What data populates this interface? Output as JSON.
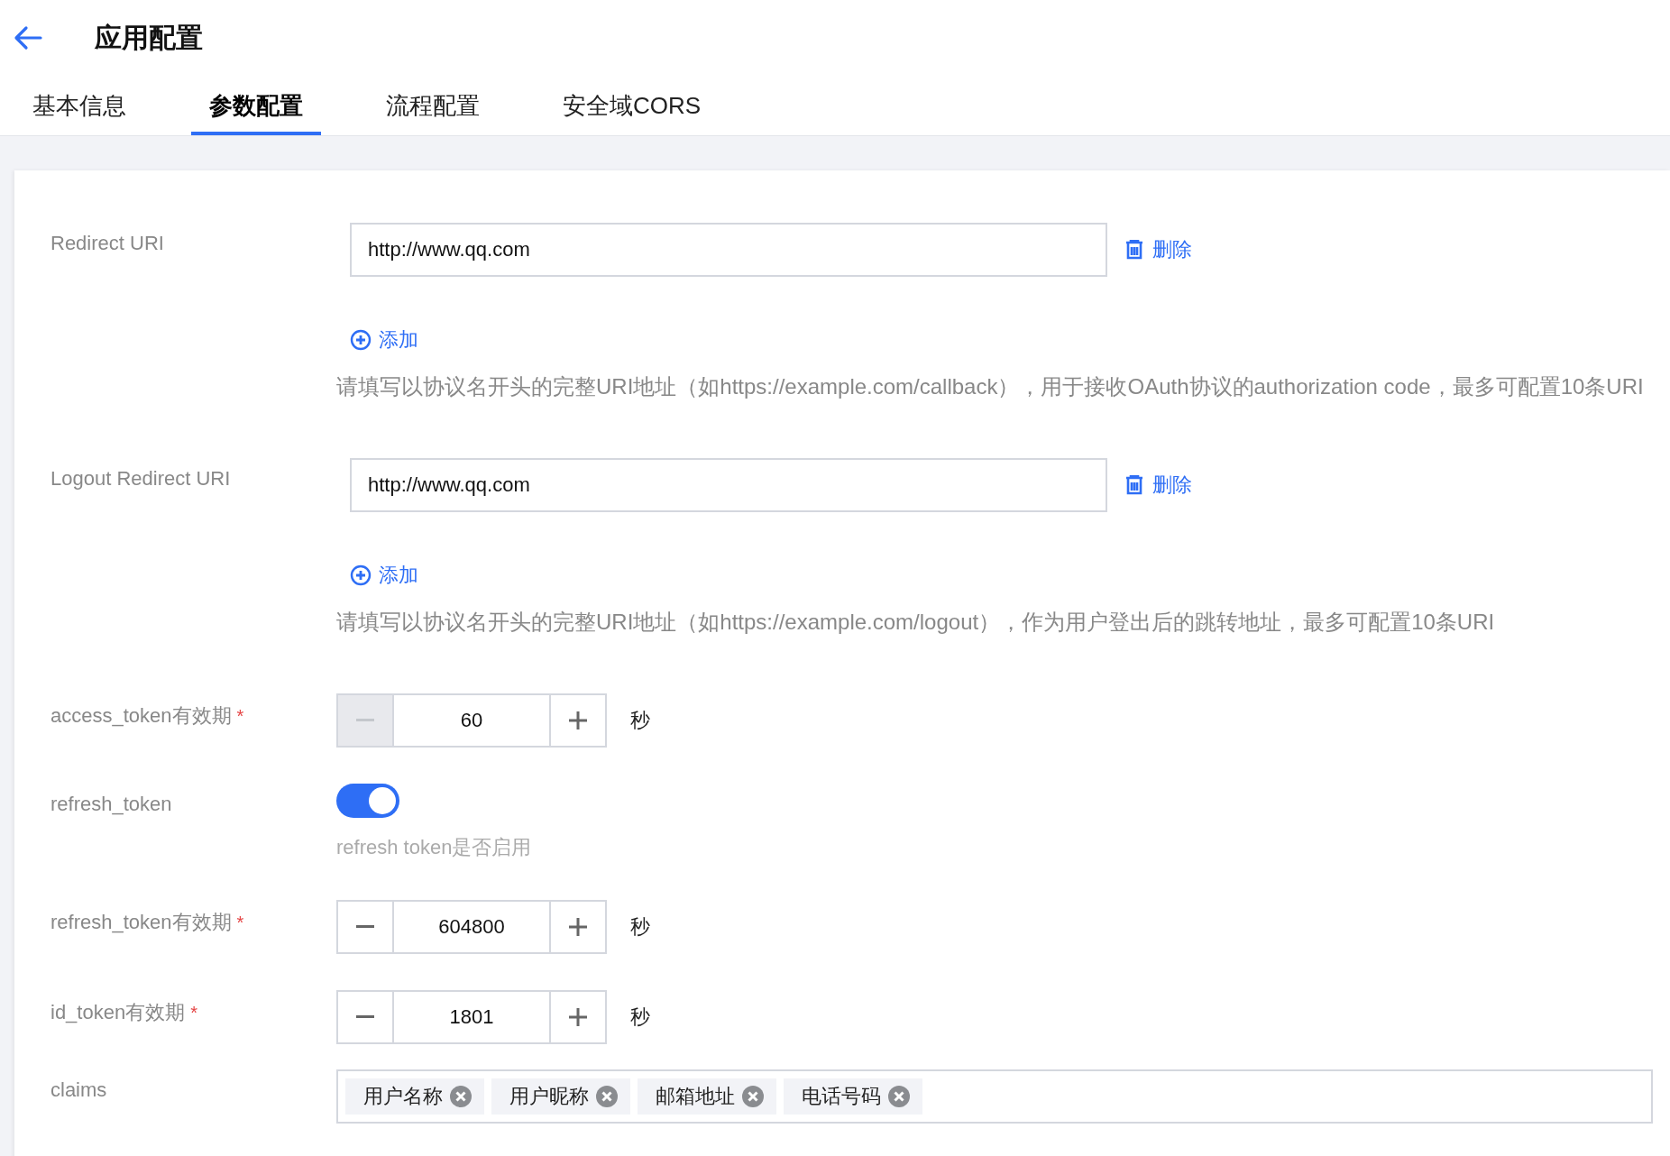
{
  "header": {
    "title": "应用配置"
  },
  "tabs": [
    {
      "label": "基本信息",
      "selected": false
    },
    {
      "label": "参数配置",
      "selected": true
    },
    {
      "label": "流程配置",
      "selected": false
    },
    {
      "label": "安全域CORS",
      "selected": false
    }
  ],
  "fields": [
    {
      "kind": "uri_list",
      "label": "Redirect URI",
      "uris": [
        {
          "value": "http://www.qq.com",
          "delete": "删除"
        }
      ],
      "add": "添加",
      "hint": "请填写以协议名开头的完整URI地址（如https://example.com/callback），用于接收OAuth协议的authorization code，最多可配置10条URI"
    },
    {
      "kind": "uri_list",
      "label": "Logout Redirect URI",
      "uris": [
        {
          "value": "http://www.qq.com",
          "delete": "删除"
        }
      ],
      "add": "添加",
      "hint": "请填写以协议名开头的完整URI地址（如https://example.com/logout），作为用户登出后的跳转地址，最多可配置10条URI"
    },
    {
      "kind": "stepper",
      "label": "access_token有效期",
      "required_mark": "*",
      "value": "60",
      "unit": "秒",
      "minus_disabled": true
    },
    {
      "kind": "switch",
      "label": "refresh_token",
      "on": true,
      "hint": "refresh token是否启用"
    },
    {
      "kind": "stepper",
      "label": "refresh_token有效期",
      "required_mark": "*",
      "value": "604800",
      "unit": "秒",
      "minus_disabled": false
    },
    {
      "kind": "stepper",
      "label": "id_token有效期",
      "required_mark": "*",
      "value": "1801",
      "unit": "秒",
      "minus_disabled": false
    },
    {
      "kind": "tags",
      "label": "claims",
      "tags": [
        "用户名称",
        "用户昵称",
        "邮箱地址",
        "电话号码"
      ]
    }
  ]
}
